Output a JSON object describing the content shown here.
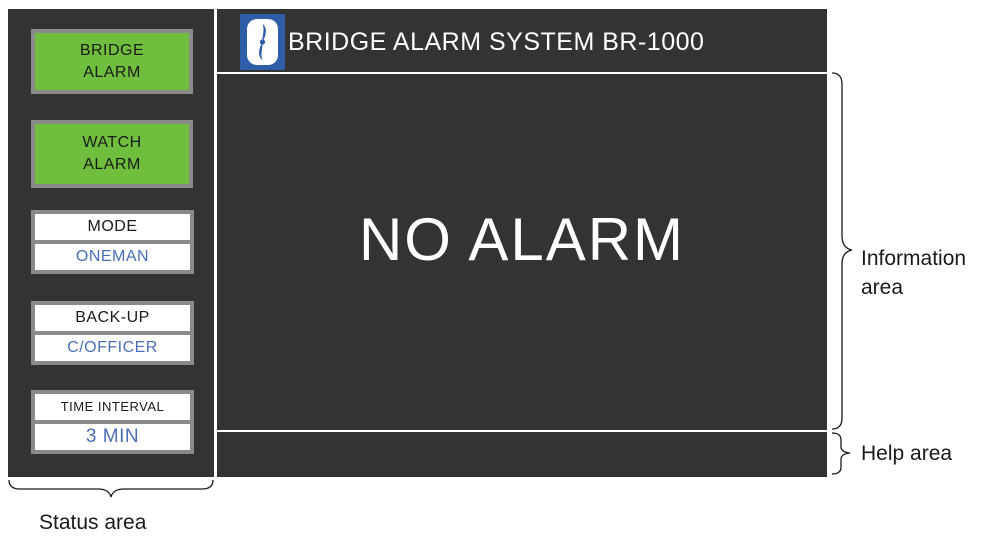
{
  "header": {
    "title": "BRIDGE ALARM SYSTEM BR-1000",
    "logo_icon": "propeller-logo-icon"
  },
  "buttons": {
    "bridge_alarm": [
      "BRIDGE",
      "ALARM"
    ],
    "watch_alarm": [
      "WATCH",
      "ALARM"
    ]
  },
  "status": {
    "mode": {
      "label": "MODE",
      "value": "ONEMAN"
    },
    "backup": {
      "label": "BACK-UP",
      "value": "C/OFFICER"
    },
    "time_interval": {
      "label": "TIME INTERVAL",
      "value": "3 MIN"
    }
  },
  "main": {
    "message": "NO ALARM",
    "help_text": ""
  },
  "annotations": {
    "information_area": [
      "Information",
      "area"
    ],
    "help_area": "Help area",
    "status_area": "Status area"
  },
  "colors": {
    "screen_bg": "#333333",
    "button_green": "#6fbe3e",
    "button_border": "#8a8a8a",
    "value_blue": "#4a6fb5",
    "logo_blue": "#2e5ea8"
  }
}
